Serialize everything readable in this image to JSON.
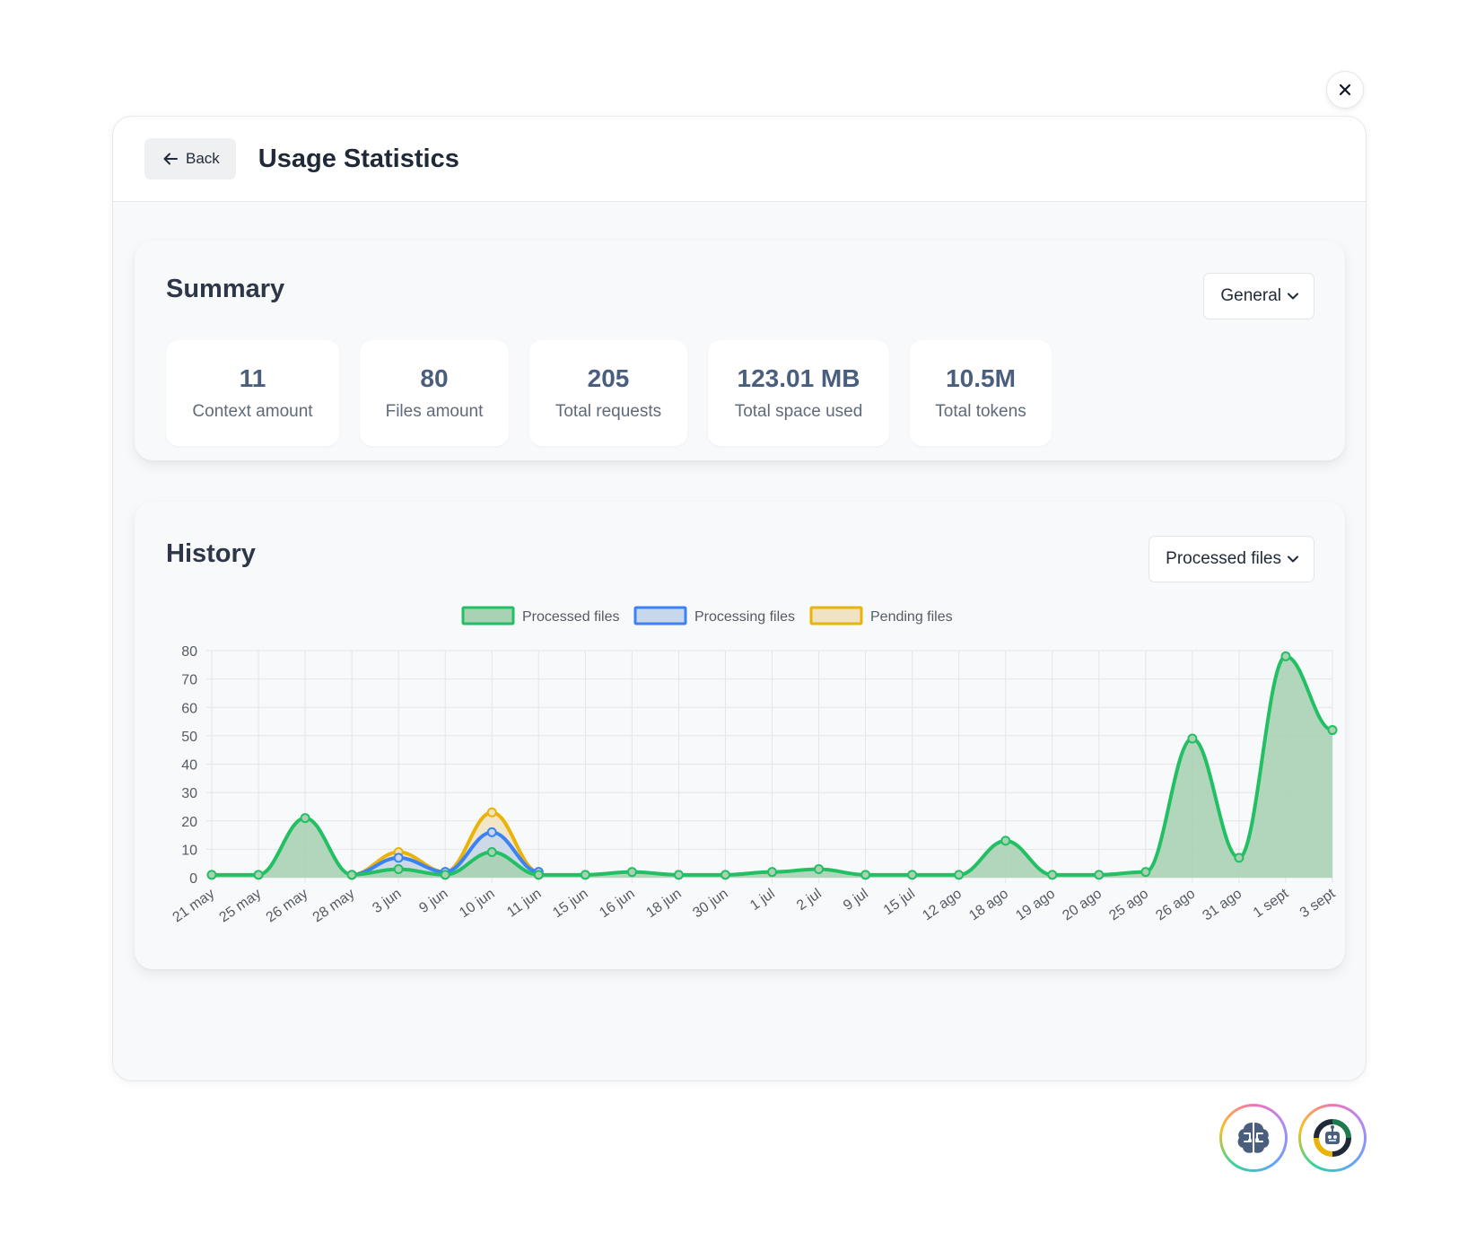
{
  "header": {
    "back_label": "Back",
    "title": "Usage Statistics"
  },
  "summary": {
    "title": "Summary",
    "filter": "General",
    "stats": [
      {
        "value": "11",
        "label": "Context amount"
      },
      {
        "value": "80",
        "label": "Files amount"
      },
      {
        "value": "205",
        "label": "Total requests"
      },
      {
        "value": "123.01 MB",
        "label": "Total space used"
      },
      {
        "value": "10.5M",
        "label": "Total tokens"
      }
    ]
  },
  "history": {
    "title": "History",
    "filter": "Processed files"
  },
  "chart_data": {
    "type": "area",
    "categories": [
      "21 may",
      "25 may",
      "26 may",
      "28 may",
      "3 jun",
      "9 jun",
      "10 jun",
      "11 jun",
      "15 jun",
      "16 jun",
      "18 jun",
      "30 jun",
      "1 jul",
      "2 jul",
      "9 jul",
      "15 jul",
      "12 ago",
      "18 ago",
      "19 ago",
      "20 ago",
      "25 ago",
      "26 ago",
      "31 ago",
      "1 sept",
      "3 sept"
    ],
    "series": [
      {
        "name": "Processed files",
        "color": "#22c063",
        "fill": "#a9d2b5",
        "values": [
          1,
          1,
          21,
          1,
          3,
          1,
          9,
          1,
          1,
          2,
          1,
          1,
          2,
          3,
          1,
          1,
          1,
          13,
          1,
          1,
          2,
          49,
          7,
          78,
          52
        ]
      },
      {
        "name": "Processing files",
        "color": "#3b82f6",
        "fill": "#c9d7ea",
        "values": [
          null,
          null,
          null,
          1,
          7,
          2,
          16,
          2,
          null,
          null,
          null,
          null,
          null,
          null,
          null,
          null,
          null,
          null,
          null,
          null,
          null,
          null,
          null,
          null,
          null
        ]
      },
      {
        "name": "Pending files",
        "color": "#eab308",
        "fill": "#efe3c3",
        "values": [
          null,
          null,
          null,
          1,
          9,
          2,
          23,
          2,
          null,
          null,
          null,
          null,
          null,
          null,
          null,
          null,
          null,
          null,
          null,
          null,
          null,
          null,
          null,
          null,
          null
        ]
      }
    ],
    "ylim": [
      0,
      80
    ],
    "yticks": [
      0,
      10,
      20,
      30,
      40,
      50,
      60,
      70,
      80
    ],
    "legend": "top",
    "grid": true,
    "xlabel": "",
    "ylabel": ""
  }
}
